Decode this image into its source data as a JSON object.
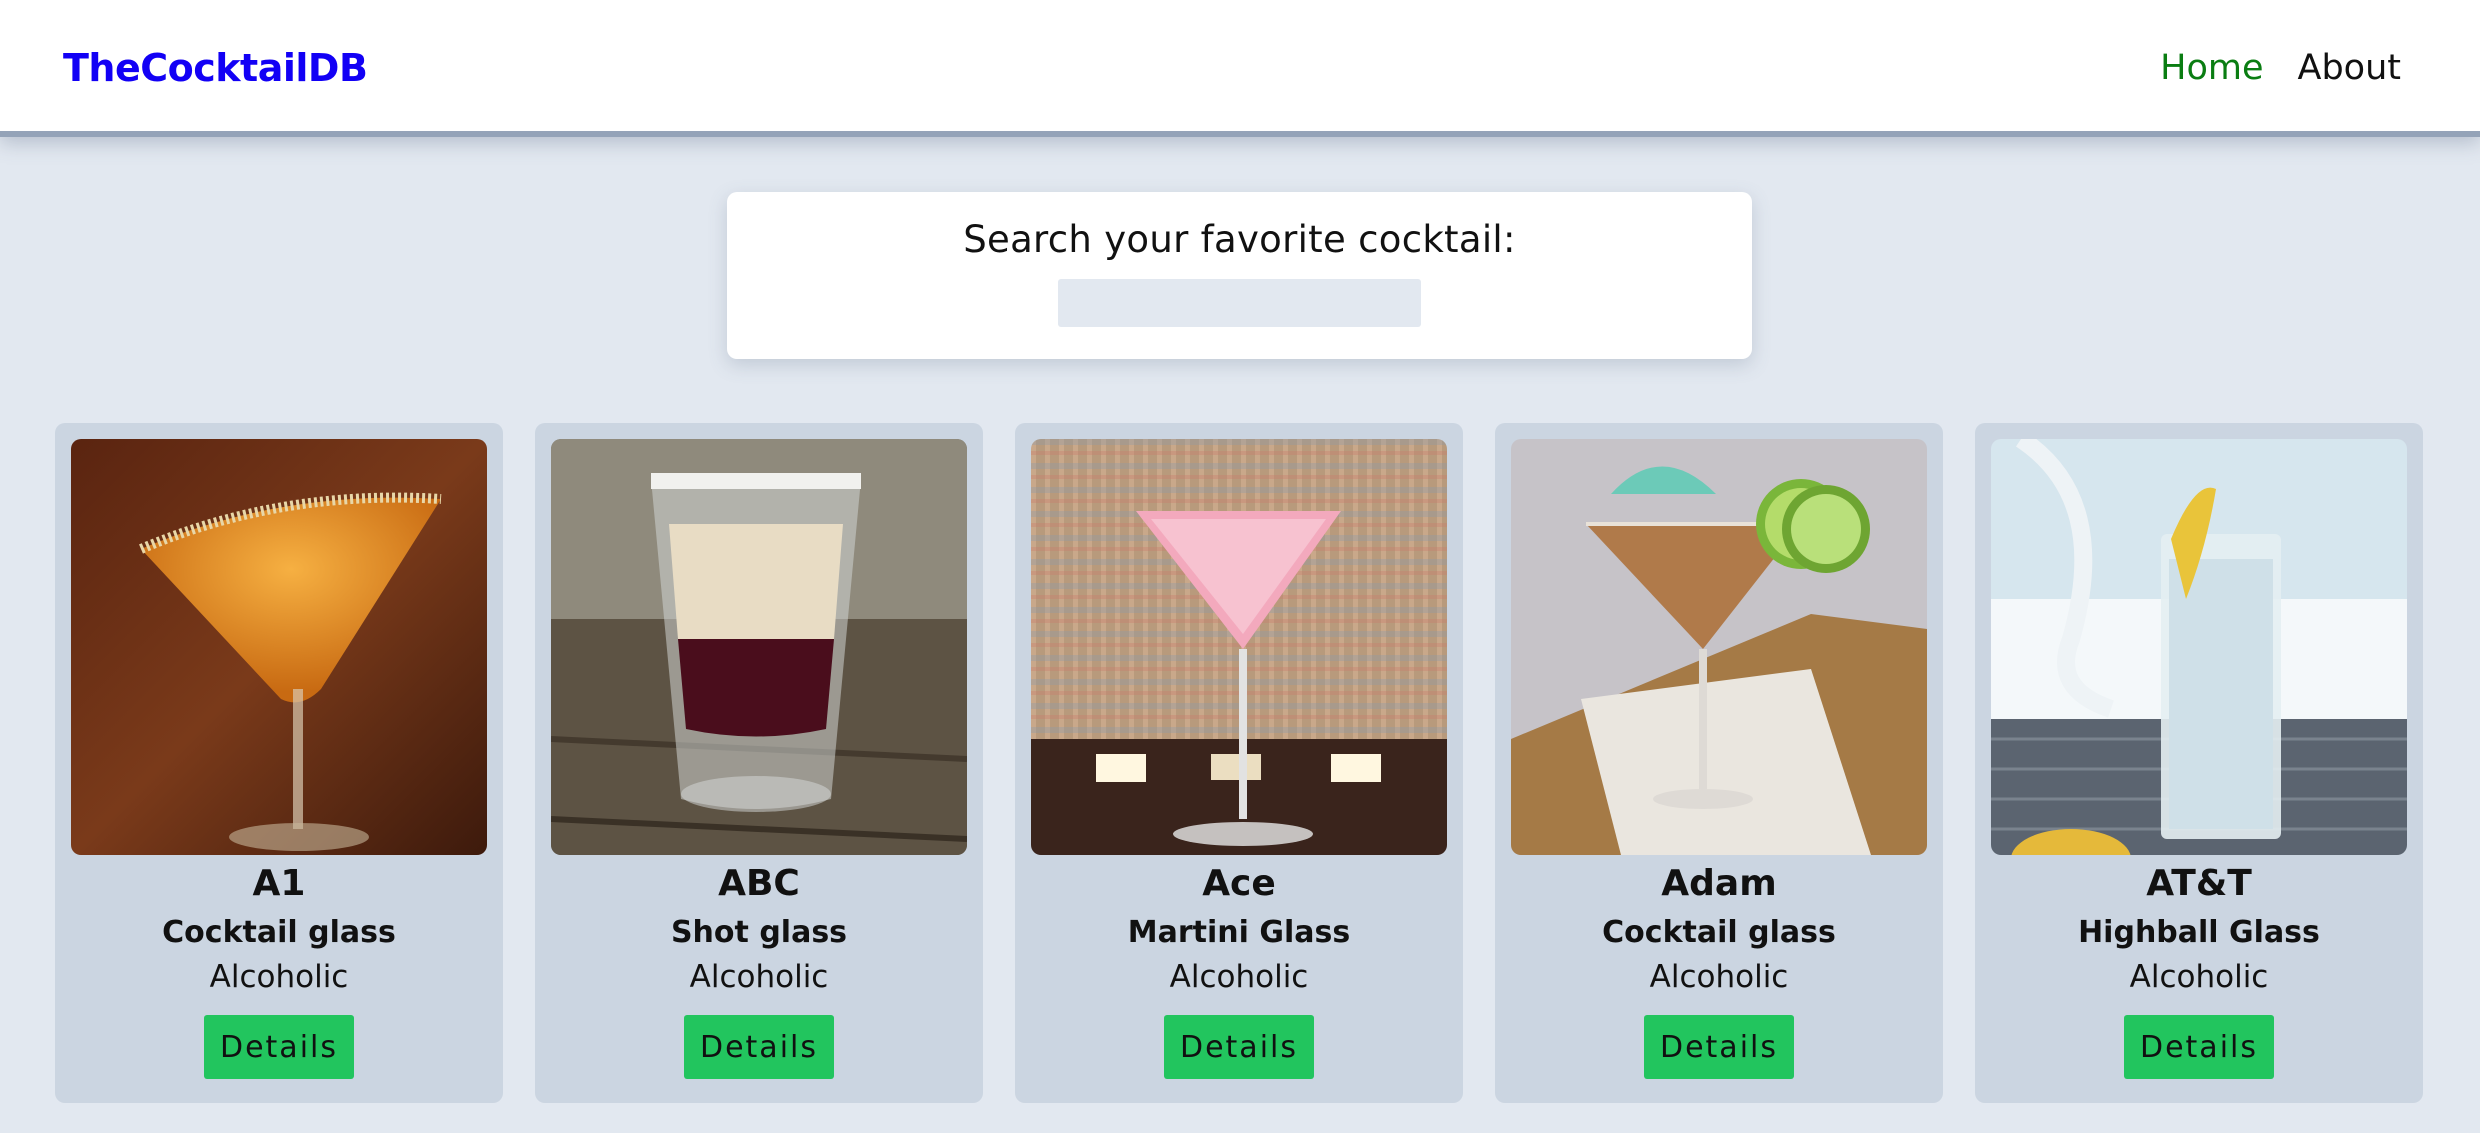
{
  "nav": {
    "logo": "TheCocktailDB",
    "links": [
      {
        "label": "Home",
        "active": true
      },
      {
        "label": "About",
        "active": false
      }
    ]
  },
  "search": {
    "label": "Search your favorite cocktail:",
    "value": "",
    "placeholder": ""
  },
  "cocktails": [
    {
      "name": "A1",
      "glass": "Cocktail glass",
      "type": "Alcoholic",
      "button": "Details"
    },
    {
      "name": "ABC",
      "glass": "Shot glass",
      "type": "Alcoholic",
      "button": "Details"
    },
    {
      "name": "Ace",
      "glass": "Martini Glass",
      "type": "Alcoholic",
      "button": "Details"
    },
    {
      "name": "Adam",
      "glass": "Cocktail glass",
      "type": "Alcoholic",
      "button": "Details"
    },
    {
      "name": "AT&T",
      "glass": "Highball Glass",
      "type": "Alcoholic",
      "button": "Details"
    }
  ],
  "colors": {
    "logo": "#1200f5",
    "active_link": "#0a7d12",
    "page_bg": "#e2e8f0",
    "card_bg": "#cbd5e1",
    "button_bg": "#22c55e"
  }
}
